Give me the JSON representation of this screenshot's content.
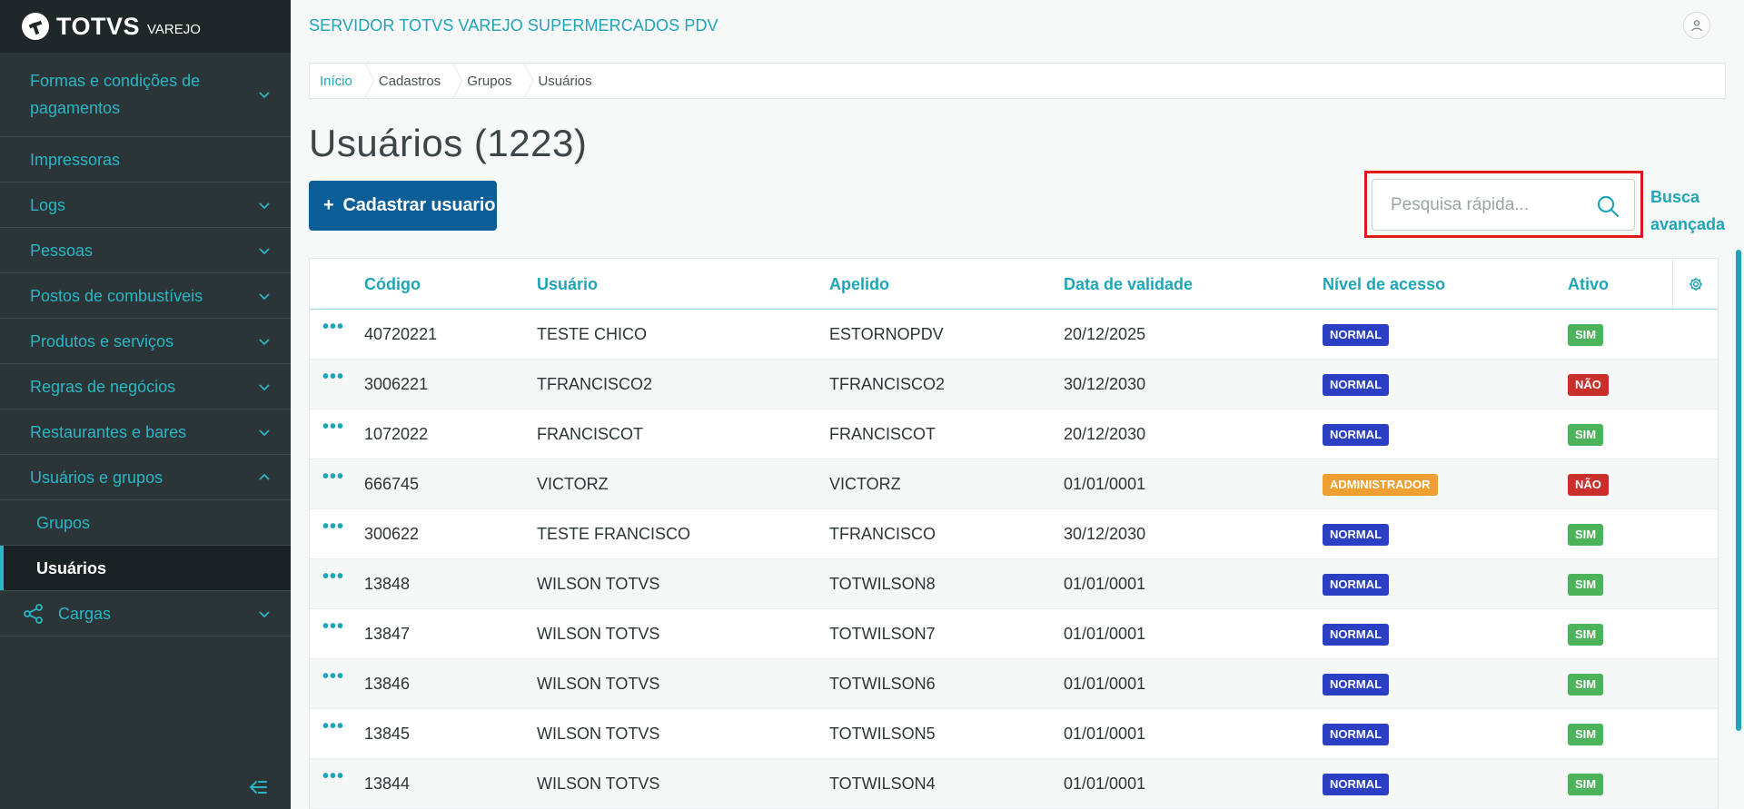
{
  "brand": {
    "name": "TOTVS",
    "sub": "VAREJO"
  },
  "colors": {
    "accent": "#1fa5b7",
    "primary_button": "#0c5f96",
    "badge_normal": "#2a3fc2",
    "badge_admin": "#f0a030",
    "badge_sim": "#4cb35a",
    "badge_nao": "#c9302c",
    "highlight_frame": "#e01a1a"
  },
  "header": {
    "server_title": "SERVIDOR TOTVS VAREJO SUPERMERCADOS PDV",
    "user_icon": "user-icon"
  },
  "sidebar": {
    "items": [
      {
        "label": "Formas e condições de pagamentos",
        "expandable": true,
        "expanded": false
      },
      {
        "label": "Impressoras",
        "expandable": false
      },
      {
        "label": "Logs",
        "expandable": true,
        "expanded": false
      },
      {
        "label": "Pessoas",
        "expandable": true,
        "expanded": false
      },
      {
        "label": "Postos de combustíveis",
        "expandable": true,
        "expanded": false
      },
      {
        "label": "Produtos e serviços",
        "expandable": true,
        "expanded": false
      },
      {
        "label": "Regras de negócios",
        "expandable": true,
        "expanded": false
      },
      {
        "label": "Restaurantes e bares",
        "expandable": true,
        "expanded": false
      },
      {
        "label": "Usuários e grupos",
        "expandable": true,
        "expanded": true
      },
      {
        "label": "Grupos",
        "sub": true
      },
      {
        "label": "Usuários",
        "sub": true,
        "active": true
      },
      {
        "label": "Cargas",
        "expandable": true,
        "expanded": false,
        "icon": "share-nodes-icon"
      }
    ],
    "collapse_icon": "collapse-menu-icon"
  },
  "breadcrumb": [
    "Início",
    "Cadastros",
    "Grupos",
    "Usuários"
  ],
  "page": {
    "title": "Usuários (1223)",
    "add_button": "Cadastrar usuario",
    "search_placeholder": "Pesquisa rápida...",
    "advanced_search_line1": "Busca",
    "advanced_search_line2": "avançada"
  },
  "table": {
    "columns": [
      "Código",
      "Usuário",
      "Apelido",
      "Data de validade",
      "Nível de acesso",
      "Ativo"
    ],
    "rows": [
      {
        "codigo": "40720221",
        "usuario": "TESTE CHICO",
        "apelido": "ESTORNOPDV",
        "validade": "20/12/2025",
        "nivel": "NORMAL",
        "ativo": "SIM"
      },
      {
        "codigo": "3006221",
        "usuario": "TFRANCISCO2",
        "apelido": "TFRANCISCO2",
        "validade": "30/12/2030",
        "nivel": "NORMAL",
        "ativo": "NÃO"
      },
      {
        "codigo": "1072022",
        "usuario": "FRANCISCOT",
        "apelido": "FRANCISCOT",
        "validade": "20/12/2030",
        "nivel": "NORMAL",
        "ativo": "SIM"
      },
      {
        "codigo": "666745",
        "usuario": "VICTORZ",
        "apelido": "VICTORZ",
        "validade": "01/01/0001",
        "nivel": "ADMINISTRADOR",
        "ativo": "NÃO"
      },
      {
        "codigo": "300622",
        "usuario": "TESTE FRANCISCO",
        "apelido": "TFRANCISCO",
        "validade": "30/12/2030",
        "nivel": "NORMAL",
        "ativo": "SIM"
      },
      {
        "codigo": "13848",
        "usuario": "WILSON TOTVS",
        "apelido": "TOTWILSON8",
        "validade": "01/01/0001",
        "nivel": "NORMAL",
        "ativo": "SIM"
      },
      {
        "codigo": "13847",
        "usuario": "WILSON TOTVS",
        "apelido": "TOTWILSON7",
        "validade": "01/01/0001",
        "nivel": "NORMAL",
        "ativo": "SIM"
      },
      {
        "codigo": "13846",
        "usuario": "WILSON TOTVS",
        "apelido": "TOTWILSON6",
        "validade": "01/01/0001",
        "nivel": "NORMAL",
        "ativo": "SIM"
      },
      {
        "codigo": "13845",
        "usuario": "WILSON TOTVS",
        "apelido": "TOTWILSON5",
        "validade": "01/01/0001",
        "nivel": "NORMAL",
        "ativo": "SIM"
      },
      {
        "codigo": "13844",
        "usuario": "WILSON TOTVS",
        "apelido": "TOTWILSON4",
        "validade": "01/01/0001",
        "nivel": "NORMAL",
        "ativo": "SIM"
      }
    ]
  }
}
